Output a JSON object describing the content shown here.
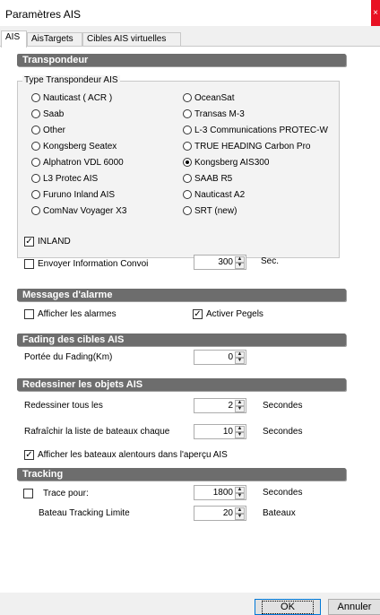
{
  "window": {
    "title": "Paramètres AIS",
    "close_glyph": "×"
  },
  "tabs": [
    {
      "label": "AIS"
    },
    {
      "label": "AisTargets"
    },
    {
      "label": "Cibles AIS virtuelles"
    }
  ],
  "transponder": {
    "header": "Transpondeur",
    "group_label": "Type Transpondeur AIS",
    "options": [
      {
        "label": "Nauticast ( ACR )"
      },
      {
        "label": "OceanSat"
      },
      {
        "label": "Saab"
      },
      {
        "label": "Transas M-3"
      },
      {
        "label": "Other"
      },
      {
        "label": "L-3 Communications PROTEC-W"
      },
      {
        "label": "Kongsberg Seatex"
      },
      {
        "label": "TRUE HEADING Carbon Pro"
      },
      {
        "label": "Alphatron VDL 6000"
      },
      {
        "label": "Kongsberg AIS300"
      },
      {
        "label": "L3 Protec AIS"
      },
      {
        "label": "SAAB R5"
      },
      {
        "label": "Furuno Inland AIS"
      },
      {
        "label": "Nauticast A2"
      },
      {
        "label": "ComNav Voyager X3"
      },
      {
        "label": "SRT (new)"
      }
    ],
    "selected": "Kongsberg AIS300",
    "inland_label": "INLAND",
    "inland_checked": true,
    "convoy_label": "Envoyer Information Convoi",
    "convoy_checked": false,
    "convoy_value": "300",
    "convoy_unit": "Sec."
  },
  "alarms": {
    "header": "Messages d'alarme",
    "show_label": "Afficher les alarmes",
    "show_checked": false,
    "pegels_label": "Activer Pegels",
    "pegels_checked": true
  },
  "fading": {
    "header": "Fading des cibles AIS",
    "range_label": "Portée du Fading(Km)",
    "range_value": "0"
  },
  "redraw": {
    "header": "Redessiner les objets AIS",
    "redraw_label": "Redessiner tous les",
    "redraw_value": "2",
    "redraw_unit": "Secondes",
    "refresh_label": "Rafraîchir la liste de bateaux chaque",
    "refresh_value": "10",
    "refresh_unit": "Secondes",
    "nearby_label": "Afficher les bateaux alentours dans l'aperçu AIS",
    "nearby_checked": true
  },
  "tracking": {
    "header": "Tracking",
    "trace_label": "Trace pour:",
    "trace_checked": false,
    "trace_value": "1800",
    "trace_unit": "Secondes",
    "limit_label": "Bateau Tracking Limite",
    "limit_value": "20",
    "limit_unit": "Bateaux"
  },
  "buttons": {
    "ok": "OK",
    "cancel": "Annuler"
  },
  "glyphs": {
    "check": "✓",
    "spin_up": "▲",
    "spin_down": "▼"
  }
}
